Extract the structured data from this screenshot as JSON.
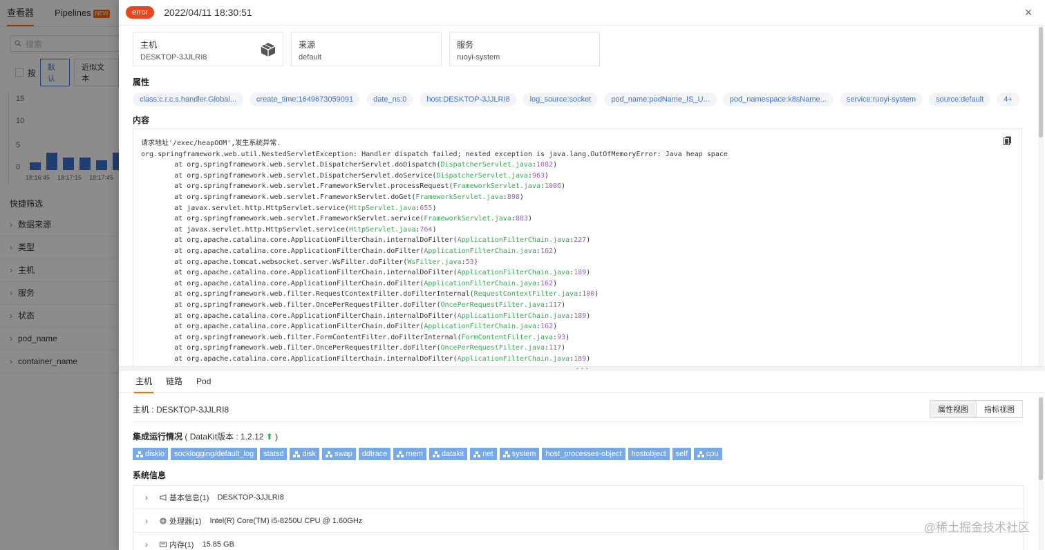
{
  "background": {
    "tabs": [
      {
        "label": "查看器",
        "active": true
      },
      {
        "label": "Pipelines",
        "badge": "NEW",
        "active": false
      }
    ],
    "search_placeholder": "搜索",
    "group_label": "按",
    "seg_buttons": [
      "默认",
      "近似文本"
    ],
    "chart_data": {
      "type": "bar",
      "y_ticks": [
        "15",
        "10",
        "5",
        "0"
      ],
      "x_labels": [
        "18:16:45",
        "18:17:15",
        "18:17:45"
      ],
      "values": [
        1.5,
        3.5,
        2.5,
        2.5,
        2,
        3.5,
        3
      ]
    },
    "quick_filter_title": "快捷筛选",
    "filters": [
      "数据来源",
      "类型",
      "主机",
      "服务",
      "状态",
      "pod_name",
      "container_name"
    ]
  },
  "drawer": {
    "level": "error",
    "time": "2022/04/11 18:30:51",
    "close_icon": "×",
    "cards": [
      {
        "label": "主机",
        "value": "DESKTOP-3JJLRI8"
      },
      {
        "label": "来源",
        "value": "default"
      },
      {
        "label": "服务",
        "value": "ruoyi-system"
      }
    ],
    "attributes_title": "属性",
    "attributes": [
      "class:c.r.c.s.handler.Global...",
      "create_time:1649673059091",
      "date_ns:0",
      "host:DESKTOP-3JJLRI8",
      "log_source:socket",
      "pod_name:podName_IS_U...",
      "pod_namespace:k8sName...",
      "service:ruoyi-system",
      "source:default",
      "4+"
    ],
    "content_title": "内容",
    "log_header": [
      "请求地址'/exec/heapOOM',发生系统异常.",
      "org.springframework.web.util.NestedServletException: Handler dispatch failed; nested exception is java.lang.OutOfMemoryError: Java heap space"
    ],
    "stack": [
      {
        "method": "org.springframework.web.servlet.DispatcherServlet.doDispatch",
        "file": "DispatcherServlet.java",
        "line": "1082"
      },
      {
        "method": "org.springframework.web.servlet.DispatcherServlet.doService",
        "file": "DispatcherServlet.java",
        "line": "963"
      },
      {
        "method": "org.springframework.web.servlet.FrameworkServlet.processRequest",
        "file": "FrameworkServlet.java",
        "line": "1006"
      },
      {
        "method": "org.springframework.web.servlet.FrameworkServlet.doGet",
        "file": "FrameworkServlet.java",
        "line": "898"
      },
      {
        "method": "javax.servlet.http.HttpServlet.service",
        "file": "HttpServlet.java",
        "line": "655"
      },
      {
        "method": "org.springframework.web.servlet.FrameworkServlet.service",
        "file": "FrameworkServlet.java",
        "line": "883"
      },
      {
        "method": "javax.servlet.http.HttpServlet.service",
        "file": "HttpServlet.java",
        "line": "764"
      },
      {
        "method": "org.apache.catalina.core.ApplicationFilterChain.internalDoFilter",
        "file": "ApplicationFilterChain.java",
        "line": "227"
      },
      {
        "method": "org.apache.catalina.core.ApplicationFilterChain.doFilter",
        "file": "ApplicationFilterChain.java",
        "line": "162"
      },
      {
        "method": "org.apache.tomcat.websocket.server.WsFilter.doFilter",
        "file": "WsFilter.java",
        "line": "53"
      },
      {
        "method": "org.apache.catalina.core.ApplicationFilterChain.internalDoFilter",
        "file": "ApplicationFilterChain.java",
        "line": "189"
      },
      {
        "method": "org.apache.catalina.core.ApplicationFilterChain.doFilter",
        "file": "ApplicationFilterChain.java",
        "line": "162"
      },
      {
        "method": "org.springframework.web.filter.RequestContextFilter.doFilterInternal",
        "file": "RequestContextFilter.java",
        "line": "100"
      },
      {
        "method": "org.springframework.web.filter.OncePerRequestFilter.doFilter",
        "file": "OncePerRequestFilter.java",
        "line": "117"
      },
      {
        "method": "org.apache.catalina.core.ApplicationFilterChain.internalDoFilter",
        "file": "ApplicationFilterChain.java",
        "line": "189"
      },
      {
        "method": "org.apache.catalina.core.ApplicationFilterChain.doFilter",
        "file": "ApplicationFilterChain.java",
        "line": "162"
      },
      {
        "method": "org.springframework.web.filter.FormContentFilter.doFilterInternal",
        "file": "FormContentFilter.java",
        "line": "93"
      },
      {
        "method": "org.springframework.web.filter.OncePerRequestFilter.doFilter",
        "file": "OncePerRequestFilter.java",
        "line": "117"
      },
      {
        "method": "org.apache.catalina.core.ApplicationFilterChain.internalDoFilter",
        "file": "ApplicationFilterChain.java",
        "line": "189"
      }
    ],
    "bottom_tabs": [
      "主机",
      "链路",
      "Pod"
    ],
    "host_label": "主机 : DESKTOP-3JJLRI8",
    "view_buttons": [
      "属性视图",
      "指标视图"
    ],
    "integration_title": "集成运行情况",
    "datakit_prefix": "( DataKit版本 : ",
    "datakit_version": "1.2.12",
    "datakit_suffix": " )",
    "plugins": [
      {
        "name": "diskio",
        "icon": true
      },
      {
        "name": "socklogging/default_log",
        "icon": false
      },
      {
        "name": "statsd",
        "icon": false
      },
      {
        "name": "disk",
        "icon": true
      },
      {
        "name": "swap",
        "icon": true
      },
      {
        "name": "ddtrace",
        "icon": false
      },
      {
        "name": "mem",
        "icon": true
      },
      {
        "name": "datakit",
        "icon": true
      },
      {
        "name": "net",
        "icon": true
      },
      {
        "name": "system",
        "icon": true
      },
      {
        "name": "host_processes-object",
        "icon": false
      },
      {
        "name": "hostobject",
        "icon": false
      },
      {
        "name": "self",
        "icon": false
      },
      {
        "name": "cpu",
        "icon": true
      }
    ],
    "system_title": "系统信息",
    "system_items": [
      {
        "key": "基本信息(1)",
        "value": "DESKTOP-3JJLRI8",
        "icon": "megaphone-icon"
      },
      {
        "key": "处理器(1)",
        "value": "Intel(R) Core(TM) i5-8250U CPU @ 1.60GHz",
        "icon": "cpu-icon"
      },
      {
        "key": "内存(1)",
        "value": "15.85 GB",
        "icon": "memory-icon"
      }
    ],
    "watermark": "@稀土掘金技术社区"
  },
  "colors": {
    "accent": "#ff6a00",
    "error": "#e8461f",
    "tag_text": "#3b6fd0",
    "plugin_bg": "#76a9e8",
    "file_green": "#3aa757",
    "line_purple": "#9b5dc6"
  }
}
